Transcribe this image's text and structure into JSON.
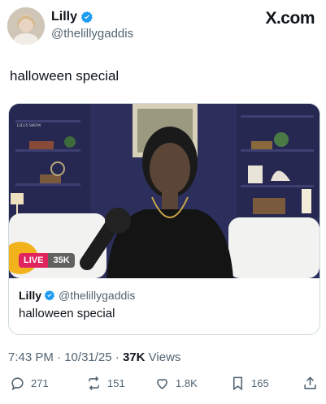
{
  "author": {
    "display_name": "Lilly",
    "handle": "@thelillygaddis",
    "avatar_icon": "profile-photo"
  },
  "brand": {
    "logo_text": "X.com"
  },
  "tweet": {
    "text": "halloween special"
  },
  "media": {
    "live_label": "LIVE",
    "live_viewers": "35K",
    "show_watermark": "LILLY SHOW"
  },
  "quoted": {
    "display_name": "Lilly",
    "handle": "@thelillygaddis",
    "text": "halloween special"
  },
  "meta": {
    "time": "7:43 PM",
    "date": "10/31/25",
    "views_count": "37K",
    "views_label": "Views"
  },
  "actions": {
    "replies": "271",
    "reposts": "151",
    "likes": "1.8K",
    "bookmarks": "165"
  },
  "colors": {
    "verified": "#1d9bf0",
    "live": "#e0245e",
    "text": "#0f1419",
    "muted": "#536471"
  }
}
